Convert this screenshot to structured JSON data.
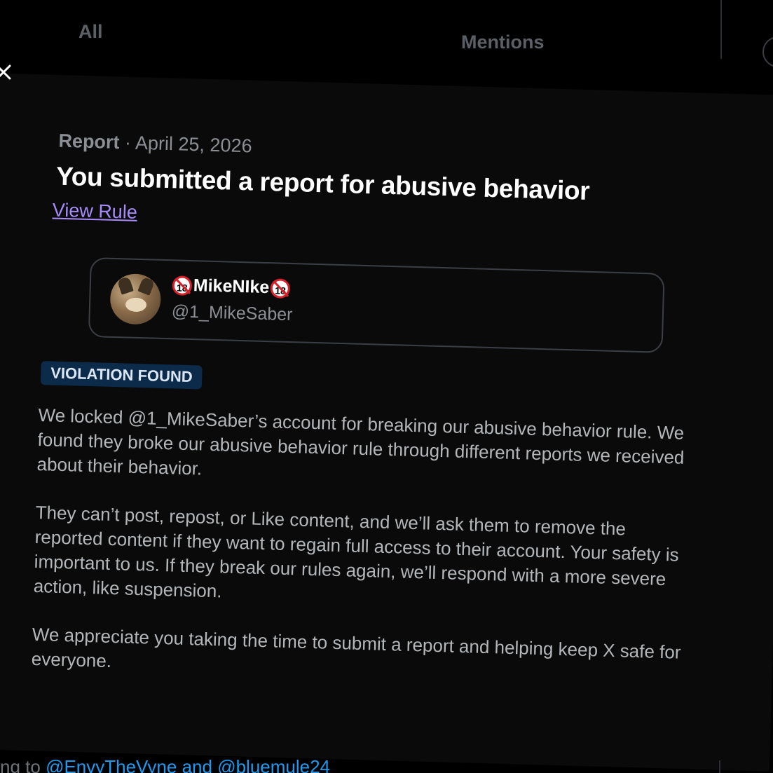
{
  "tabs": {
    "all_label": "All",
    "mentions_label": "Mentions"
  },
  "modal": {
    "close_icon": "close-icon",
    "meta_kind": "Report",
    "meta_separator": " · ",
    "meta_date": "April 25, 2026",
    "heading": "You submitted a report for abusive behavior",
    "view_rule_label": "View Rule",
    "user_card": {
      "display_name": "MikeNIke",
      "handle": "@1_MikeSaber",
      "age_icon_text": "18",
      "age_icon_color": "#d6202a"
    },
    "badge_label": "VIOLATION FOUND",
    "badge_color": "#0c2a4a",
    "paragraphs": [
      "We locked @1_MikeSaber’s account for breaking our abusive behavior rule. We found they broke our abusive behavior rule through different reports we received about their behavior.",
      "They can’t post, repost, or Like content, and we’ll ask them to remove the reported content if they want to regain full access to their account. Your safety is important to us. If they break our rules again, we’ll respond with a more severe action, like suspension.",
      "We appreciate you taking the time to submit a report and helping keep X safe for everyone."
    ]
  },
  "background_bottom": {
    "prefix": "ng to ",
    "mention_1": "@EnvyTheVyne",
    "joiner": " and ",
    "mention_2": "@bluemule24"
  },
  "colors": {
    "link": "#a78bfa",
    "mention": "#1d9bf0",
    "background": "#000000"
  }
}
